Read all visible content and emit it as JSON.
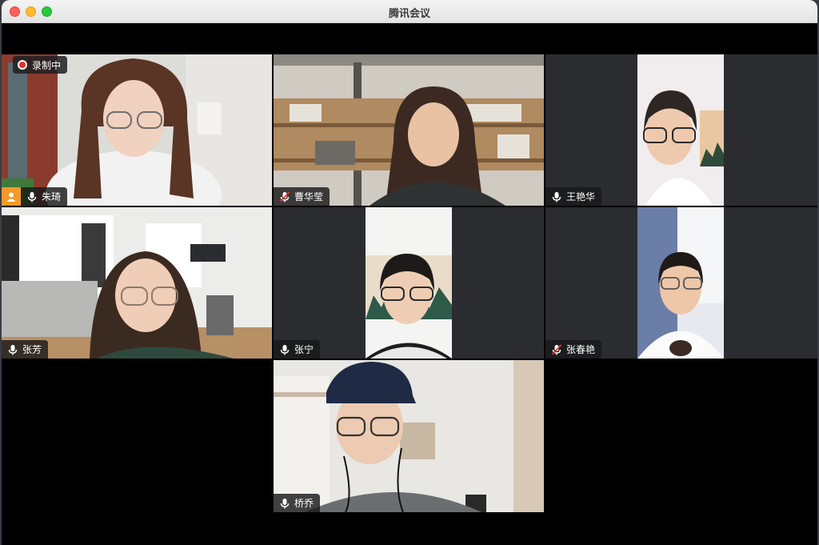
{
  "window": {
    "title": "腾讯会议"
  },
  "recording": {
    "label": "录制中"
  },
  "participants": [
    {
      "name": "朱琦",
      "mic": "on",
      "host": true
    },
    {
      "name": "曹华莹",
      "mic": "muted"
    },
    {
      "name": "王艳华",
      "mic": "on"
    },
    {
      "name": "张芳",
      "mic": "on"
    },
    {
      "name": "张宁",
      "mic": "on"
    },
    {
      "name": "张春艳",
      "mic": "muted"
    },
    {
      "name": "桥乔",
      "mic": "on"
    }
  ],
  "colors": {
    "host_badge": "#f39a2a",
    "recording_dot": "#e5322d",
    "muted_slash": "#e5322d"
  }
}
